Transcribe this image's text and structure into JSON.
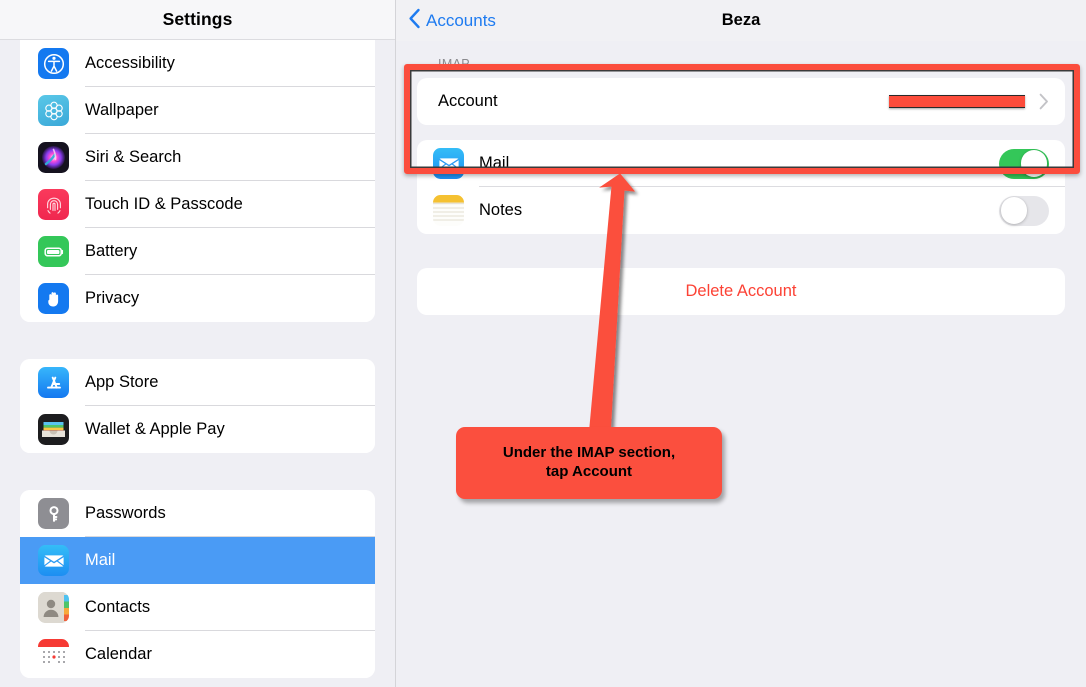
{
  "sidebar": {
    "header": {
      "title": "Settings"
    },
    "groups": [
      {
        "clipped": true,
        "items": [
          {
            "label": "",
            "icon": "partial-blue-icon",
            "partial": true
          },
          {
            "label": "Accessibility",
            "icon": "accessibility-icon"
          },
          {
            "label": "Wallpaper",
            "icon": "wallpaper-icon"
          },
          {
            "label": "Siri & Search",
            "icon": "siri-icon"
          },
          {
            "label": "Touch ID & Passcode",
            "icon": "touch-id-icon"
          },
          {
            "label": "Battery",
            "icon": "battery-icon"
          },
          {
            "label": "Privacy",
            "icon": "privacy-hand-icon"
          }
        ]
      },
      {
        "clipped": false,
        "items": [
          {
            "label": "App Store",
            "icon": "app-store-icon"
          },
          {
            "label": "Wallet & Apple Pay",
            "icon": "wallet-icon"
          }
        ]
      },
      {
        "clipped": false,
        "items": [
          {
            "label": "Passwords",
            "icon": "passwords-key-icon"
          },
          {
            "label": "Mail",
            "icon": "mail-icon",
            "selected": true
          },
          {
            "label": "Contacts",
            "icon": "contacts-icon"
          },
          {
            "label": "Calendar",
            "icon": "calendar-icon"
          }
        ]
      }
    ]
  },
  "detail": {
    "back_label": "Accounts",
    "title": "Beza",
    "imap_section": {
      "header": "IMAP",
      "account_row": {
        "label": "Account",
        "value": "",
        "value_redacted": true,
        "disclosure": "chevron-right-icon"
      }
    },
    "services": [
      {
        "label": "Mail",
        "icon": "mail-icon",
        "enabled": true
      },
      {
        "label": "Notes",
        "icon": "notes-icon",
        "enabled": false
      }
    ],
    "delete_label": "Delete Account"
  },
  "annotation": {
    "callout_text": "Under the IMAP section,\ntap Account",
    "highlight_color": "#fb4d3d",
    "callout_bg": "#fb4f3e",
    "callout_fg": "#000000"
  },
  "colors": {
    "ios_blue": "#1e7bf0",
    "selection_blue": "#4a9bf5",
    "toggle_on_green": "#34c759",
    "destructive_red": "#fc4235",
    "group_bg": "#efeff4"
  }
}
